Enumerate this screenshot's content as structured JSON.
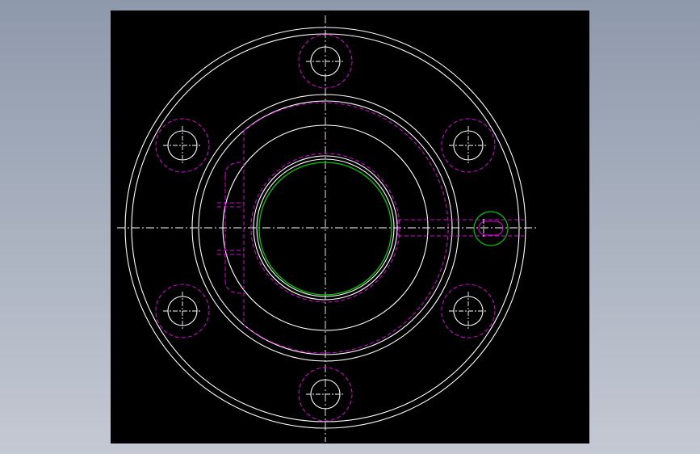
{
  "viewport": {
    "background": "#000000"
  },
  "colors": {
    "outline": "#ffffff",
    "hidden": "#e000e0",
    "highlight": "#00c800",
    "centerline": "#ffffff",
    "app_background_top": "#8e99ab",
    "app_background_bottom": "#c4c9d3"
  },
  "drawing": {
    "view": "front view",
    "bolt_hole_count": 6,
    "side_port": "right"
  }
}
